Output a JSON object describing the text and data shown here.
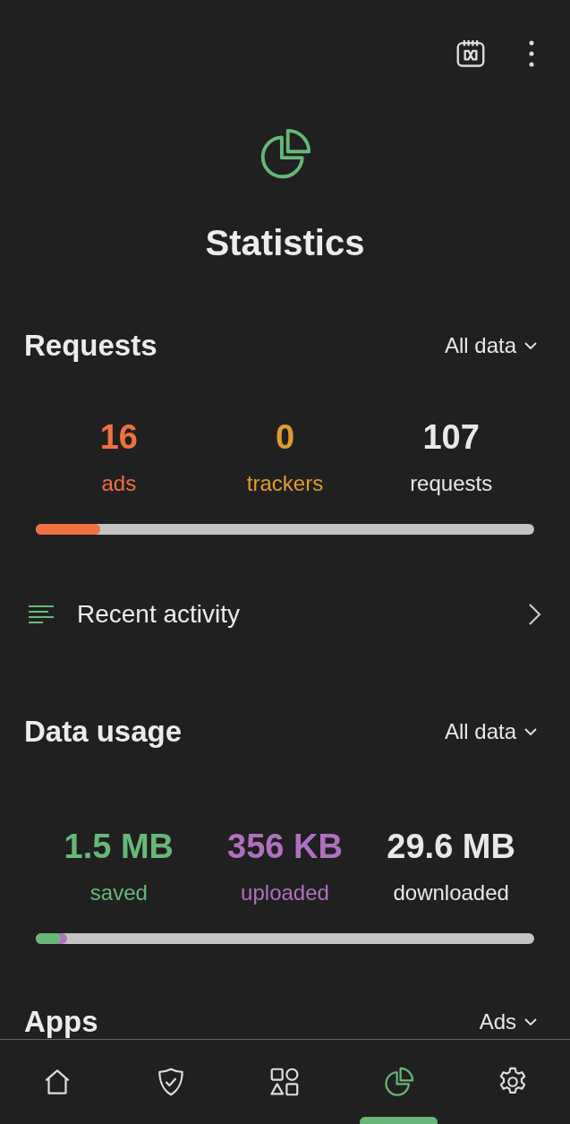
{
  "title": "Statistics",
  "requests": {
    "title": "Requests",
    "filter": "All data",
    "stats": [
      {
        "value": "16",
        "label": "ads",
        "color": "#f07040"
      },
      {
        "value": "0",
        "label": "trackers",
        "color": "#e09a30"
      },
      {
        "value": "107",
        "label": "requests",
        "color": "#e8e8e8"
      }
    ],
    "bar": [
      {
        "level": 0.13,
        "color": "#f07040"
      }
    ]
  },
  "recent_activity": {
    "label": "Recent activity"
  },
  "data_usage": {
    "title": "Data usage",
    "filter": "All data",
    "stats": [
      {
        "value": "1.5 MB",
        "label": "saved",
        "color": "#67b878"
      },
      {
        "value": "356 KB",
        "label": "uploaded",
        "color": "#b070c0"
      },
      {
        "value": "29.6 MB",
        "label": "downloaded",
        "color": "#e8e8e8"
      }
    ],
    "bar": [
      {
        "level": 0.012,
        "color": "#b070c0"
      },
      {
        "level": 0.05,
        "color": "#67b878"
      }
    ]
  },
  "apps": {
    "title": "Apps",
    "filter": "Ads"
  },
  "nav": [
    {
      "kind": "home",
      "selected": false
    },
    {
      "kind": "protection",
      "selected": false
    },
    {
      "kind": "apps",
      "selected": false
    },
    {
      "kind": "statistics",
      "selected": true
    },
    {
      "kind": "settings",
      "selected": false
    }
  ]
}
